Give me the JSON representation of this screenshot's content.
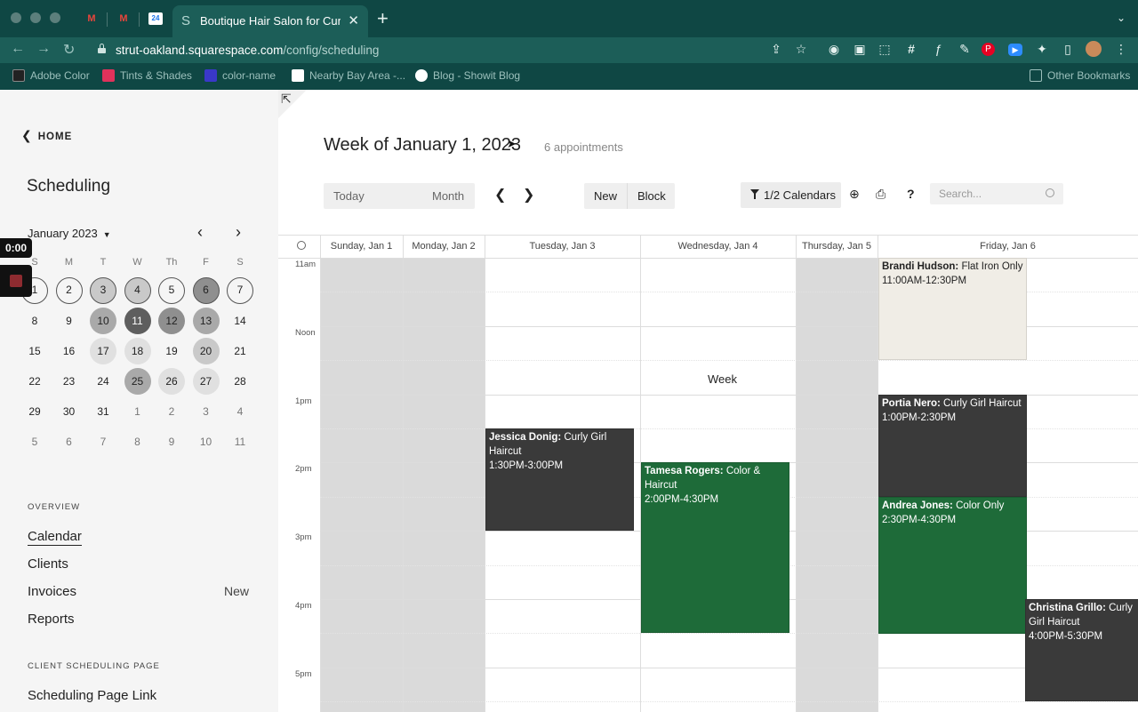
{
  "browser": {
    "tab_title": "Boutique Hair Salon for Curly H",
    "url_host": "strut-oakland.squarespace.com",
    "url_path": "/config/scheduling",
    "bookmarks": [
      "Adobe Color",
      "Tints & Shades",
      "color-name",
      "Nearby Bay Area -...",
      "Blog - Showit Blog"
    ],
    "other_bookmarks": "Other Bookmarks"
  },
  "sidebar": {
    "home": "HOME",
    "title": "Scheduling",
    "mini_month": "January 2023",
    "dow": [
      "S",
      "M",
      "T",
      "W",
      "Th",
      "F",
      "S"
    ],
    "days": [
      [
        "1",
        "2",
        "3",
        "4",
        "5",
        "6",
        "7"
      ],
      [
        "8",
        "9",
        "10",
        "11",
        "12",
        "13",
        "14"
      ],
      [
        "15",
        "16",
        "17",
        "18",
        "19",
        "20",
        "21"
      ],
      [
        "22",
        "23",
        "24",
        "25",
        "26",
        "27",
        "28"
      ],
      [
        "29",
        "30",
        "31",
        "1",
        "2",
        "3",
        "4"
      ],
      [
        "5",
        "6",
        "7",
        "8",
        "9",
        "10",
        "11"
      ]
    ],
    "overview_label": "OVERVIEW",
    "nav": [
      "Calendar",
      "Clients",
      "Invoices",
      "Reports"
    ],
    "invoices_badge": "New",
    "client_page_label": "CLIENT SCHEDULING PAGE",
    "scheduling_link": "Scheduling Page Link"
  },
  "recorder": {
    "time": "0:00"
  },
  "main": {
    "week_title": "Week of January 1, 2023",
    "appointment_count": "6 appointments",
    "views": [
      "Today",
      "Week",
      "Month"
    ],
    "active_view": "Week",
    "new_label": "New",
    "block_label": "Block",
    "calendars_label": "1/2 Calendars",
    "search_placeholder": "Search...",
    "help_label": "?"
  },
  "calendar": {
    "columns": [
      "Sunday, Jan 1",
      "Monday, Jan 2",
      "Tuesday, Jan 3",
      "Wednesday, Jan 4",
      "Thursday, Jan 5",
      "Friday, Jan 6"
    ],
    "time_labels": [
      "11am",
      "Noon",
      "1pm",
      "2pm",
      "3pm",
      "4pm",
      "5pm"
    ],
    "appointments": [
      {
        "client": "Brandi Hudson:",
        "service": "Flat Iron Only",
        "time": "11:00AM-12:30PM",
        "day": "Friday, Jan 6",
        "color": "#f0ede6"
      },
      {
        "client": "Portia Nero:",
        "service": "Curly Girl Haircut",
        "time": "1:00PM-2:30PM",
        "day": "Friday, Jan 6",
        "color": "#3a3a3a"
      },
      {
        "client": "Jessica Donig:",
        "service": "Curly Girl Haircut",
        "time": "1:30PM-3:00PM",
        "day": "Tuesday, Jan 3",
        "color": "#3a3a3a"
      },
      {
        "client": "Tamesa Rogers:",
        "service": "Color & Haircut",
        "time": "2:00PM-4:30PM",
        "day": "Wednesday, Jan 4",
        "color": "#1e6b39"
      },
      {
        "client": "Andrea Jones:",
        "service": "Color Only",
        "time": "2:30PM-4:30PM",
        "day": "Friday, Jan 6",
        "color": "#1e6b39"
      },
      {
        "client": "Christina Grillo:",
        "service": "Curly Girl Haircut",
        "time": "4:00PM-5:30PM",
        "day": "Friday, Jan 6",
        "color": "#3a3a3a"
      }
    ]
  }
}
